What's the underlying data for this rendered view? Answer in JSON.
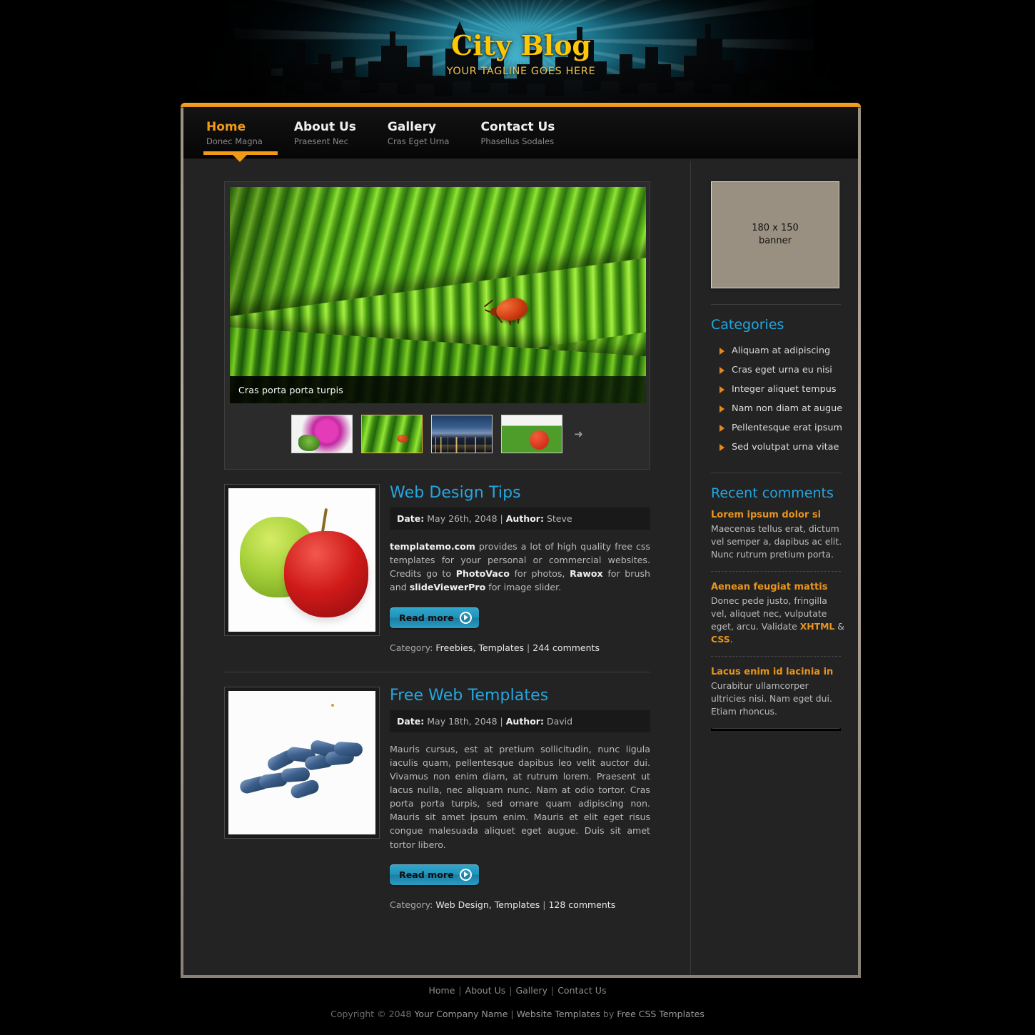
{
  "header": {
    "title": "City Blog",
    "tagline": "YOUR TAGLINE GOES HERE"
  },
  "nav": {
    "items": [
      {
        "label": "Home",
        "sub": "Donec Magna",
        "active": true
      },
      {
        "label": "About Us",
        "sub": "Praesent Nec",
        "active": false
      },
      {
        "label": "Gallery",
        "sub": "Cras Eget Urna",
        "active": false
      },
      {
        "label": "Contact Us",
        "sub": "Phasellus Sodales",
        "active": false
      }
    ]
  },
  "slider": {
    "caption": "Cras porta porta turpis",
    "thumbs": [
      {
        "name": "orchid-thumbnail"
      },
      {
        "name": "leaf-bug-thumbnail"
      },
      {
        "name": "city-skyline-thumbnail"
      },
      {
        "name": "tomato-vegetables-thumbnail"
      }
    ],
    "next_icon": "➜"
  },
  "posts": [
    {
      "title": "Web Design Tips",
      "date_label": "Date:",
      "date": "May 26th, 2048",
      "meta_sep": "|",
      "author_label": "Author:",
      "author": "Steve",
      "body_parts": [
        {
          "text": "templatemo.com",
          "bold": true
        },
        {
          "text": " provides a lot of high quality free css templates for your personal or commercial websites. Credits go to ",
          "bold": false
        },
        {
          "text": "PhotoVaco",
          "bold": true
        },
        {
          "text": " for photos, ",
          "bold": false
        },
        {
          "text": "Rawox",
          "bold": true
        },
        {
          "text": " for brush and ",
          "bold": false
        },
        {
          "text": "slideViewerPro",
          "bold": true
        },
        {
          "text": " for image slider.",
          "bold": false
        }
      ],
      "read_more": "Read more",
      "category_label": "Category:",
      "categories": "Freebies, Templates",
      "cat_sep": "|",
      "comments": "244 comments"
    },
    {
      "title": "Free Web Templates",
      "date_label": "Date:",
      "date": "May 18th, 2048",
      "meta_sep": "|",
      "author_label": "Author:",
      "author": "David",
      "body_parts": [
        {
          "text": "Mauris cursus, est at pretium sollicitudin, nunc ligula iaculis quam, pellentesque dapibus leo velit auctor dui. Vivamus non enim diam, at rutrum lorem. Praesent ut lacus nulla, nec aliquam nunc. Nam at odio tortor. Cras porta porta turpis, sed ornare quam adipiscing non. Mauris sit amet ipsum enim. Mauris et elit eget risus congue malesuada aliquet eget augue. Duis sit amet tortor libero.",
          "bold": false
        }
      ],
      "read_more": "Read more",
      "category_label": "Category:",
      "categories": "Web Design, Templates",
      "cat_sep": "|",
      "comments": "128 comments"
    }
  ],
  "sidebar": {
    "banner": {
      "size": "180 x 150",
      "caption": "banner"
    },
    "categories_heading": "Categories",
    "categories": [
      "Aliquam at adipiscing",
      "Cras eget urna eu nisi",
      "Integer aliquet tempus",
      "Nam non diam at augue",
      "Pellentesque erat ipsum",
      "Sed volutpat urna vitae"
    ],
    "comments_heading": "Recent comments",
    "comments": [
      {
        "title": "Lorem ipsum dolor si",
        "parts": [
          {
            "text": "Maecenas tellus erat, dictum vel semper a, dapibus ac elit. Nunc rutrum pretium porta.",
            "bold": false
          }
        ]
      },
      {
        "title": "Aenean feugiat mattis",
        "parts": [
          {
            "text": "Donec pede justo, fringilla vel, aliquet nec, vulputate eget, arcu. Validate ",
            "bold": false
          },
          {
            "text": "XHTML",
            "bold": true
          },
          {
            "text": " & ",
            "bold": false
          },
          {
            "text": "CSS",
            "bold": true
          },
          {
            "text": ".",
            "bold": false
          }
        ]
      },
      {
        "title": "Lacus enim id lacinia in",
        "parts": [
          {
            "text": "Curabitur ullamcorper ultricies nisi. Nam eget dui. Etiam rhoncus.",
            "bold": false
          }
        ]
      }
    ]
  },
  "footer": {
    "links": [
      "Home",
      "About Us",
      "Gallery",
      "Contact Us"
    ],
    "separator": "|",
    "copyright_pre": "Copyright © 2048 ",
    "company": "Your Company Name",
    "mid_sep": " | ",
    "templates_link": "Website Templates",
    "by": " by ",
    "credit_link": "Free CSS Templates"
  },
  "colors": {
    "accent_orange": "#f09a16",
    "accent_blue": "#24a6e0",
    "brand_gold": "#fdc703",
    "page_bg": "#232323",
    "banner_bg": "#9a9082"
  }
}
